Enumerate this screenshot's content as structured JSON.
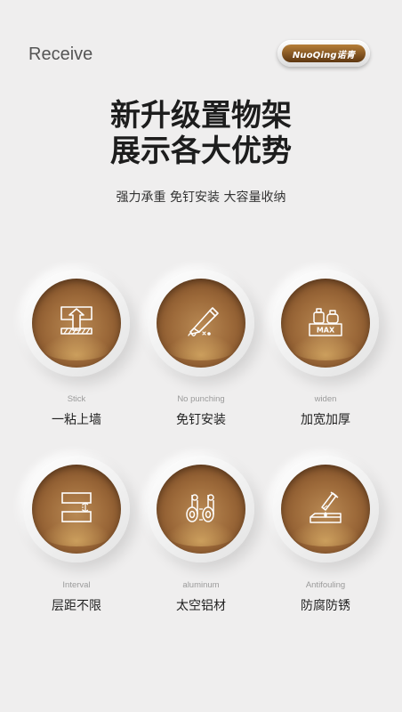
{
  "header": {
    "title": "Receive",
    "brand": "NuoQing诺青"
  },
  "headline": {
    "line1": "新升级置物架",
    "line2": "展示各大优势",
    "subtitle": "强力承重 免钉安装 大容量收纳"
  },
  "features": [
    {
      "en": "Stick",
      "cn": "一粘上墙",
      "icon": "wall-mount-icon"
    },
    {
      "en": "No punching",
      "cn": "免钉安装",
      "icon": "glue-tube-icon"
    },
    {
      "en": "widen",
      "cn": "加宽加厚",
      "icon": "max-load-icon"
    },
    {
      "en": "Interval",
      "cn": "层距不限",
      "icon": "interval-icon"
    },
    {
      "en": "aluminum",
      "cn": "太空铝材",
      "icon": "aluminum-rolls-icon"
    },
    {
      "en": "Antifouling",
      "cn": "防腐防锈",
      "icon": "antifouling-icon"
    }
  ],
  "icon_text": {
    "max_label": "MAX"
  },
  "colors": {
    "background": "#efeeee",
    "circle_brown": "#9d6a3a",
    "brand_brown": "#7a4a1c"
  }
}
